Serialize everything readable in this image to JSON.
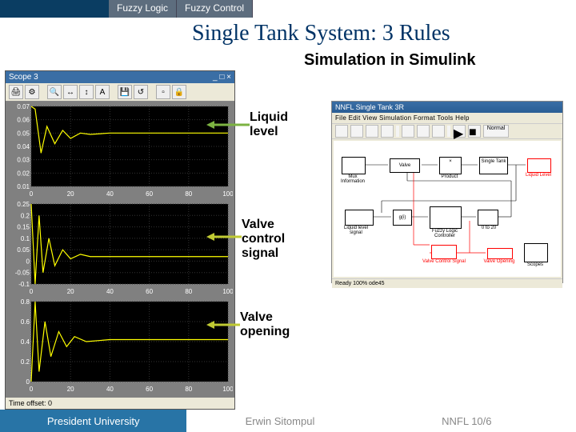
{
  "tabs": {
    "t1": "Fuzzy Logic",
    "t2": "Fuzzy Control"
  },
  "title": "Single Tank System: 3 Rules",
  "subtitle": "Simulation in Simulink",
  "scope": {
    "title": "Scope 3",
    "toolbar_icons": [
      "print-icon",
      "params-icon",
      "zoom-in-icon",
      "zoom-x-icon",
      "zoom-y-icon",
      "autoscale-icon",
      "save-icon",
      "restore-icon",
      "float-icon",
      "lock-icon"
    ],
    "time_offset": "Time offset: 0"
  },
  "annotations": {
    "a1": "Liquid\nlevel",
    "a2": "Valve\ncontrol\nsignal",
    "a3": "Valve\nopening"
  },
  "simulink": {
    "title": "NNFL Single Tank 3R",
    "menu": "File  Edit  View  Simulation  Format  Tools  Help",
    "toolbar_icons": [
      "new-icon",
      "open-icon",
      "save-icon",
      "print-icon",
      "cut-icon",
      "copy-icon",
      "paste-icon",
      "undo-icon",
      "redo-icon",
      "play-icon",
      "stop-icon",
      "normal-icon"
    ],
    "blocks": {
      "muxinfo": "Mux Information",
      "valve": "Valve",
      "product": "Product",
      "tank": "Single Tank",
      "liquid": "Liquid Level",
      "liquidlbl": "Liquid Level",
      "setpoint": "Liquid level signal",
      "gain": "g(i)",
      "fuzzy": "Fuzzy Logic Controller",
      "sat": "0 to 20",
      "vcs": "Valve Control Signal",
      "vopen": "Valve Opening",
      "scopes": "Scopes"
    },
    "status": "Ready                                      100%                                      ode45"
  },
  "footer": {
    "left": "President University",
    "mid": "Erwin Sitompul",
    "right": "NNFL 10/6"
  },
  "chart_data": [
    {
      "type": "line",
      "title": "Liquid level",
      "xlim": [
        0,
        100
      ],
      "ylim": [
        0.01,
        0.07
      ],
      "yticks": [
        0.01,
        0.02,
        0.03,
        0.04,
        0.05,
        0.06,
        0.07
      ],
      "xticks": [
        0,
        20,
        40,
        60,
        80,
        100
      ],
      "series": [
        {
          "name": "Liquid level",
          "color": "#ffff00",
          "x": [
            0,
            2,
            5,
            8,
            12,
            16,
            20,
            25,
            30,
            40,
            60,
            80,
            100
          ],
          "y": [
            0.07,
            0.068,
            0.035,
            0.055,
            0.042,
            0.052,
            0.046,
            0.05,
            0.049,
            0.05,
            0.05,
            0.05,
            0.05
          ]
        }
      ]
    },
    {
      "type": "line",
      "title": "Valve control signal",
      "xlim": [
        0,
        100
      ],
      "ylim": [
        -0.1,
        0.25
      ],
      "yticks": [
        -0.1,
        -0.05,
        0,
        0.05,
        0.1,
        0.15,
        0.2,
        0.25
      ],
      "xticks": [
        0,
        20,
        40,
        60,
        80,
        100
      ],
      "series": [
        {
          "name": "Valve control signal",
          "color": "#ffff00",
          "x": [
            0,
            2,
            4,
            6,
            9,
            12,
            16,
            20,
            25,
            30,
            40,
            60,
            80,
            100
          ],
          "y": [
            0.25,
            -0.1,
            0.2,
            -0.05,
            0.1,
            -0.02,
            0.05,
            0.01,
            0.03,
            0.02,
            0.02,
            0.02,
            0.02,
            0.02
          ]
        }
      ]
    },
    {
      "type": "line",
      "title": "Valve opening",
      "xlim": [
        0,
        100
      ],
      "ylim": [
        0,
        0.8
      ],
      "yticks": [
        0,
        0.2,
        0.4,
        0.6,
        0.8
      ],
      "xticks": [
        0,
        20,
        40,
        60,
        80,
        100
      ],
      "series": [
        {
          "name": "Valve opening",
          "color": "#ffff00",
          "x": [
            0,
            2,
            4,
            7,
            10,
            14,
            18,
            22,
            28,
            40,
            60,
            80,
            100
          ],
          "y": [
            0,
            0.8,
            0.1,
            0.6,
            0.25,
            0.5,
            0.35,
            0.45,
            0.4,
            0.42,
            0.42,
            0.42,
            0.42
          ]
        }
      ]
    }
  ]
}
